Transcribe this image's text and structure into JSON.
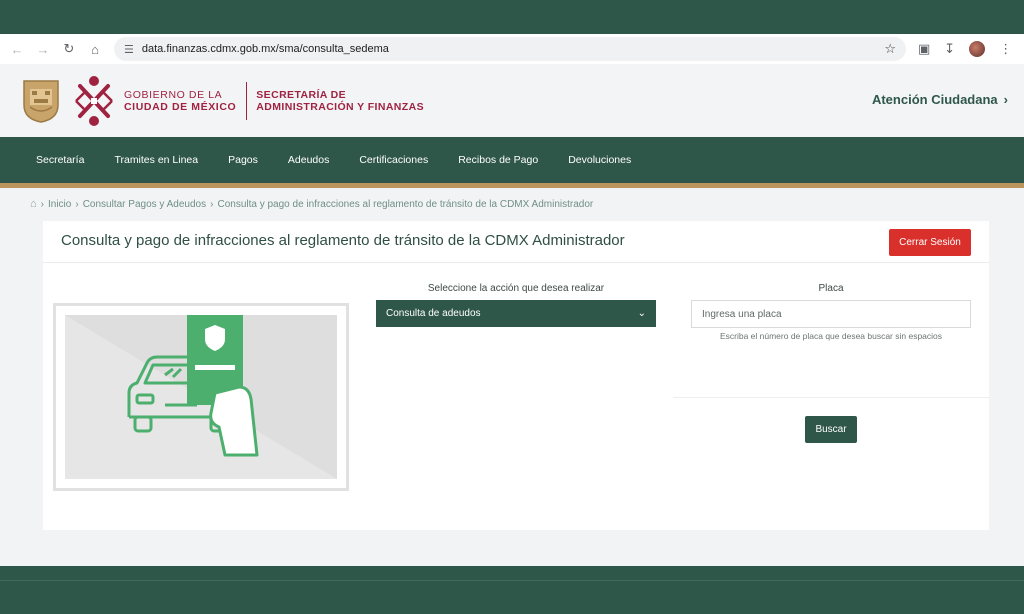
{
  "browser": {
    "url": "data.finanzas.cdmx.gob.mx/sma/consulta_sedema"
  },
  "header": {
    "gov_line1": "GOBIERNO DE LA",
    "gov_line2": "CIUDAD DE MÉXICO",
    "sec_line1": "SECRETARÍA DE",
    "sec_line2": "ADMINISTRACIÓN Y FINANZAS",
    "atencion": "Atención Ciudadana"
  },
  "nav": {
    "items": [
      "Secretaría",
      "Tramites en Linea",
      "Pagos",
      "Adeudos",
      "Certificaciones",
      "Recibos de Pago",
      "Devoluciones"
    ]
  },
  "breadcrumb": {
    "items": [
      "Inicio",
      "Consultar Pagos y Adeudos",
      "Consulta y pago de infracciones al reglamento de tránsito de la CDMX Administrador"
    ]
  },
  "card": {
    "title": "Consulta y pago de infracciones al reglamento de tránsito de la CDMX Administrador",
    "logout_label": "Cerrar Sesión",
    "action_label": "Seleccione la acción que desea realizar",
    "action_value": "Consulta de adeudos",
    "plate_label": "Placa",
    "plate_placeholder": "Ingresa una placa",
    "plate_hint": "Escriba el número de placa que desea buscar sin espacios",
    "search_label": "Buscar"
  },
  "colors": {
    "brand_green": "#2f5749",
    "brand_wine": "#9f2241",
    "gold": "#bc955c",
    "danger": "#d9302b",
    "illustration_green": "#4caf6e"
  }
}
